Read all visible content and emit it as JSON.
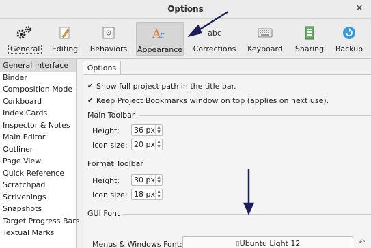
{
  "window": {
    "title": "Options",
    "close_glyph": "✕"
  },
  "toolbar": {
    "items": [
      {
        "label": "General",
        "icon": "gears-icon"
      },
      {
        "label": "Editing",
        "icon": "pencil-icon"
      },
      {
        "label": "Behaviors",
        "icon": "behaviors-icon"
      },
      {
        "label": "Appearance",
        "icon": "appearance-icon"
      },
      {
        "label": "Corrections",
        "icon": "abc-icon",
        "icon_text": "abc"
      },
      {
        "label": "Keyboard",
        "icon": "keyboard-icon"
      },
      {
        "label": "Sharing",
        "icon": "sharing-icon"
      },
      {
        "label": "Backup",
        "icon": "backup-icon"
      }
    ],
    "selected": "Appearance"
  },
  "sidebar": {
    "items": [
      "General Interface",
      "Binder",
      "Composition Mode",
      "Corkboard",
      "Index Cards",
      "Inspector & Notes",
      "Main Editor",
      "Outliner",
      "Page View",
      "Quick Reference",
      "Scratchpad",
      "Scrivenings",
      "Snapshots",
      "Target Progress Bars",
      "Textual Marks"
    ],
    "selected": "General Interface"
  },
  "options": {
    "tab": "Options",
    "check1": "Show full project path in the title bar.",
    "check2": "Keep Project Bookmarks window on top (applies on next use).",
    "main_toolbar": {
      "title": "Main Toolbar",
      "height_label": "Height:",
      "height_value": "36 px",
      "icon_label": "Icon size:",
      "icon_value": "20 px"
    },
    "format_toolbar": {
      "title": "Format Toolbar",
      "height_label": "Height:",
      "height_value": "30 px",
      "icon_label": "Icon size:",
      "icon_value": "18 px"
    },
    "gui_font": {
      "title": "GUI Font",
      "label": "Menus & Windows Font:",
      "value": "Ubuntu Light 12"
    }
  },
  "colors": {
    "annotation_arrow": "#1a1f5c",
    "appearance_icon": "#e07a3a",
    "backup_icon": "#3a9ad9"
  }
}
